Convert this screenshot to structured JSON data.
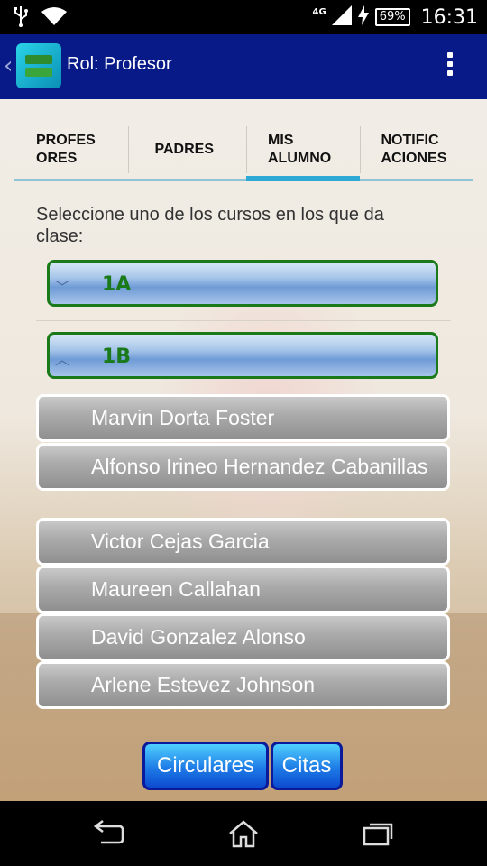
{
  "status_bar": {
    "network": "4G",
    "battery": "69%",
    "time": "16:31",
    "icons": [
      "usb-icon",
      "wifi-icon",
      "signal-icon",
      "charging-icon",
      "battery-icon"
    ]
  },
  "action_bar": {
    "title": "Rol: Profesor",
    "icons": [
      "back-chevron-icon",
      "app-logo-icon",
      "overflow-menu-icon"
    ]
  },
  "tabs": [
    {
      "line1": "PROFES",
      "line2": "ORES",
      "selected": false
    },
    {
      "line1": "PADRES",
      "line2": "",
      "selected": false
    },
    {
      "line1": "MIS",
      "line2": "ALUMNO",
      "selected": true
    },
    {
      "line1": "NOTIFIC",
      "line2": "ACIONES",
      "selected": false
    }
  ],
  "instruction": "Seleccione uno de los cursos en los que da clase:",
  "courses": [
    {
      "name": "1A",
      "expanded": false
    },
    {
      "name": "1B",
      "expanded": true
    }
  ],
  "students": [
    "Marvin Dorta Foster",
    "Alfonso Irineo Hernandez Cabanillas",
    "Victor Cejas Garcia",
    "Maureen Callahan",
    "David Gonzalez Alonso",
    "Arlene Estevez Johnson"
  ],
  "buttons": {
    "circulares": "Circulares",
    "citas": "Citas"
  },
  "colors": {
    "action_bar": "#081a88",
    "tab_indicator": "#2ea9d6",
    "group_border": "#1a7a1a",
    "button_border": "#0a1a9a"
  },
  "nav_icons": [
    "back-icon",
    "home-icon",
    "recent-apps-icon"
  ]
}
